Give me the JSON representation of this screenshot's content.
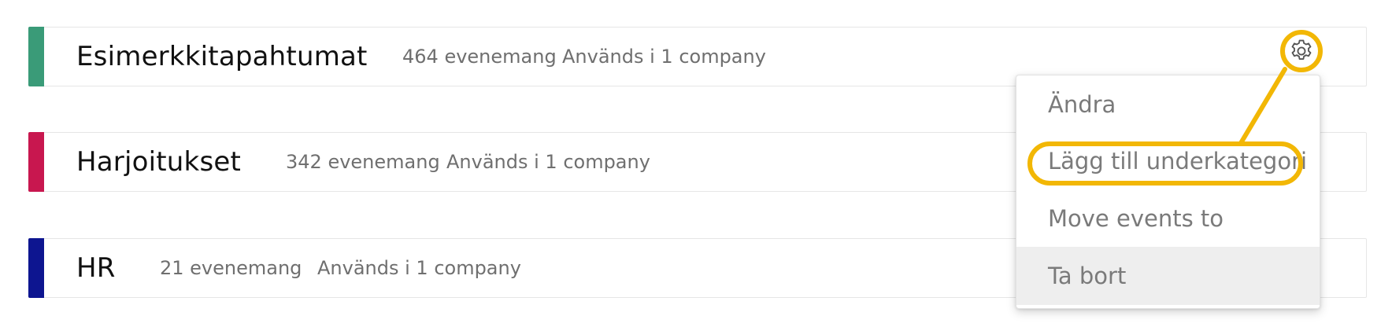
{
  "categories": [
    {
      "name": "Esimerkkitapahtumat",
      "event_count": "464 evenemang",
      "usage": "Används i 1 company",
      "color": "#3a9b78"
    },
    {
      "name": "Harjoitukset",
      "event_count": "342 evenemang",
      "usage": "Används i 1 company",
      "color": "#c8174f"
    },
    {
      "name": "HR",
      "event_count": "21 evenemang",
      "usage": "Används i 1 company",
      "color": "#0d1590"
    }
  ],
  "settings_menu": {
    "trigger_icon": "gear-icon",
    "items": [
      {
        "label": "Ändra"
      },
      {
        "label": "Lägg till underkategori"
      },
      {
        "label": "Move events to"
      },
      {
        "label": "Ta bort"
      }
    ],
    "hovered_item": "Ta bort",
    "highlighted_item": "Lägg till underkategori"
  },
  "colors": {
    "annotation": "#f2b705",
    "menu_text": "#7a7a7a",
    "meta_text": "#6f6f6f"
  }
}
